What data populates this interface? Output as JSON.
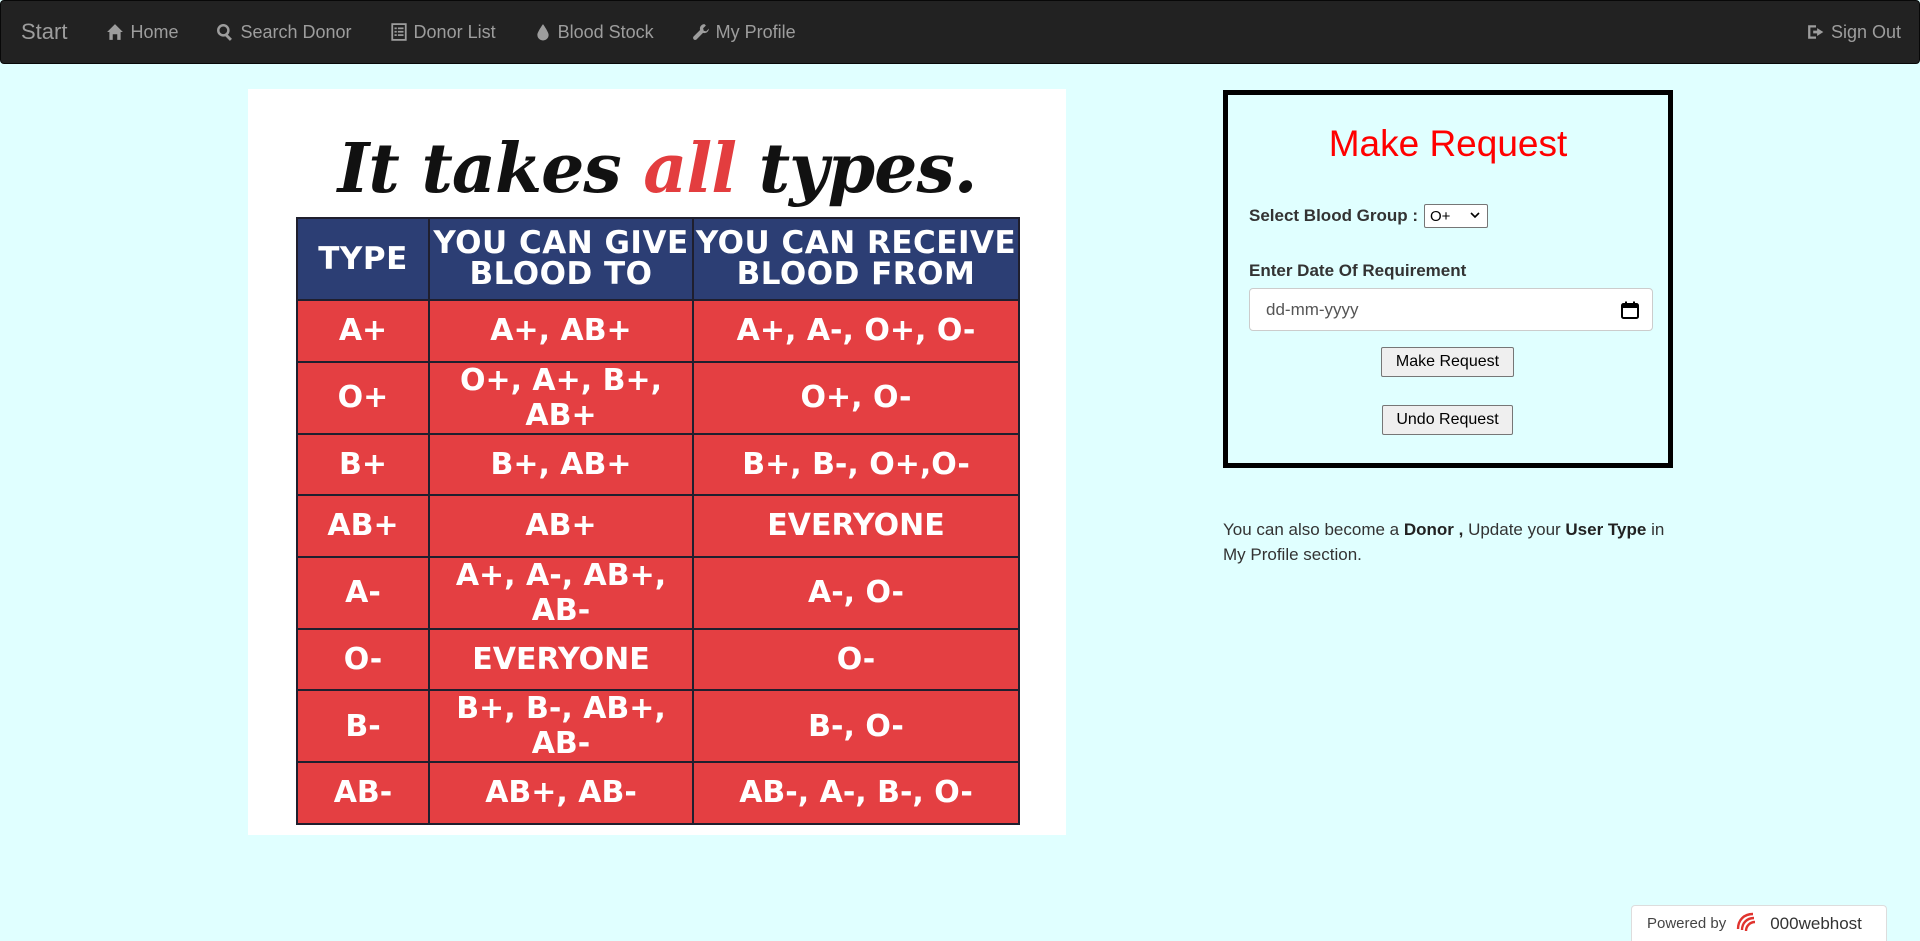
{
  "nav": {
    "brand": "Start",
    "items": [
      {
        "label": "Home",
        "icon": "home-icon"
      },
      {
        "label": "Search Donor",
        "icon": "search-icon"
      },
      {
        "label": "Donor List",
        "icon": "list-icon"
      },
      {
        "label": "Blood Stock",
        "icon": "drop-icon"
      },
      {
        "label": "My Profile",
        "icon": "wrench-icon"
      }
    ],
    "signout": {
      "label": "Sign Out",
      "icon": "sign-out-icon"
    }
  },
  "poster": {
    "title_pre": "It takes ",
    "title_accent": "all",
    "title_post": " types.",
    "headers": [
      "TYPE",
      "YOU CAN GIVE BLOOD TO",
      "YOU CAN RECEIVE BLOOD FROM"
    ],
    "rows": [
      [
        "A+",
        "A+, AB+",
        "A+, A-, O+, O-"
      ],
      [
        "O+",
        "O+, A+, B+, AB+",
        "O+, O-"
      ],
      [
        "B+",
        "B+, AB+",
        "B+, B-, O+,O-"
      ],
      [
        "AB+",
        "AB+",
        "EVERYONE"
      ],
      [
        "A-",
        "A+, A-, AB+, AB-",
        "A-, O-"
      ],
      [
        "O-",
        "EVERYONE",
        "O-"
      ],
      [
        "B-",
        "B+, B-, AB+, AB-",
        "B-, O-"
      ],
      [
        "AB-",
        "AB+, AB-",
        "AB-, A-, B-, O-"
      ]
    ]
  },
  "request": {
    "title": "Make Request",
    "group_label": "Select Blood Group :",
    "group_value": "O+",
    "date_label": "Enter Date Of Requirement",
    "date_placeholder": "dd-mm-yyyy",
    "make_button": "Make Request",
    "undo_button": "Undo Request"
  },
  "info": {
    "t1": "You can also become a ",
    "b1": "Donor ,",
    "t2": " Update your ",
    "b2": "User Type",
    "t3": " in My Profile section."
  },
  "powered": {
    "prefix": "Powered by",
    "brand": "000webhost"
  },
  "colors": {
    "page_bg": "#e0ffff",
    "navbar_bg": "#222222",
    "request_title": "#ff0000",
    "table_header": "#2c3e74",
    "table_cell": "#e43f42",
    "title_accent": "#e33d3f"
  }
}
